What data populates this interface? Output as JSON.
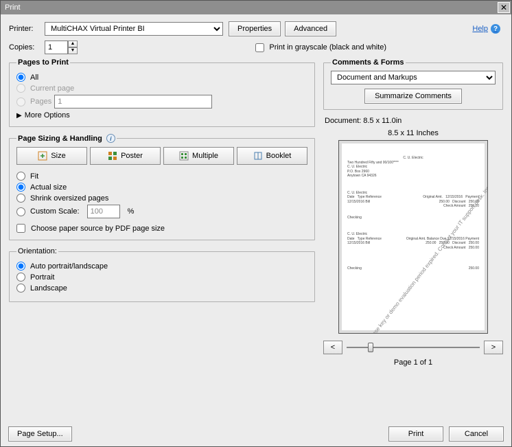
{
  "title": "Print",
  "close_glyph": "✕",
  "printer_label": "Printer:",
  "printer_selected": "MultiCHAX Virtual Printer BI",
  "properties_btn": "Properties",
  "advanced_btn": "Advanced",
  "help_label": "Help",
  "copies_label": "Copies:",
  "copies_value": "1",
  "grayscale_label": "Print in grayscale (black and white)",
  "pages_to_print": {
    "legend": "Pages to Print",
    "all": "All",
    "current": "Current page",
    "pages": "Pages",
    "pages_value": "1",
    "more_options": "More Options"
  },
  "sizing": {
    "legend": "Page Sizing & Handling",
    "tabs": {
      "size": "Size",
      "poster": "Poster",
      "multiple": "Multiple",
      "booklet": "Booklet"
    },
    "fit": "Fit",
    "actual": "Actual size",
    "shrink": "Shrink oversized pages",
    "custom": "Custom Scale:",
    "custom_value": "100",
    "percent": "%",
    "choose_source": "Choose paper source by PDF page size"
  },
  "orientation": {
    "legend": "Orientation:",
    "auto": "Auto portrait/landscape",
    "portrait": "Portrait",
    "landscape": "Landscape"
  },
  "comments": {
    "legend": "Comments & Forms",
    "selected": "Document and Markups",
    "summarize": "Summarize Comments"
  },
  "preview": {
    "doc_size": "Document: 8.5 x 11.0in",
    "page_size": "8.5 x 11 Inches",
    "watermark": "Incorrect license key or demo evaluation period expired. Contact your IT support desk. Incorrect license ke",
    "prev": "<",
    "next": ">",
    "page_of": "Page 1 of 1"
  },
  "footer": {
    "page_setup": "Page Setup...",
    "print": "Print",
    "cancel": "Cancel"
  }
}
